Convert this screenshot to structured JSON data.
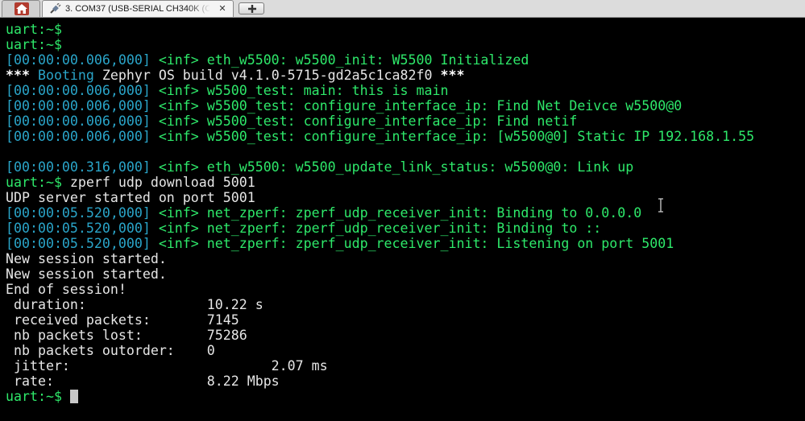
{
  "tabs": {
    "home": {
      "icon": "home-icon"
    },
    "session": {
      "icon": "plug-icon",
      "label": "3. COM37  (USB-SERIAL CH340K (C",
      "close_glyph": "✕"
    },
    "new_tab": {
      "icon": "plus-icon"
    }
  },
  "colors": {
    "background": "#000000",
    "prompt": "#2ee86a",
    "timestamp": "#2aa5c9",
    "log": "#2ee86a",
    "plain": "#e6e6e6"
  },
  "terminal": {
    "lines": [
      {
        "segments": [
          {
            "text": "uart:~$",
            "color": "green"
          }
        ]
      },
      {
        "segments": [
          {
            "text": "uart:~$",
            "color": "green"
          }
        ]
      },
      {
        "segments": [
          {
            "text": "[00:00:00.006,000]",
            "color": "cyan"
          },
          {
            "text": " <inf> eth_w5500: w5500_init: W5500 Initialized",
            "color": "green"
          }
        ]
      },
      {
        "segments": [
          {
            "text": "*** ",
            "color": "bold"
          },
          {
            "text": "Booting",
            "color": "cyan"
          },
          {
            "text": " Zephyr OS build v4.1.0-5715-gd2a5c1ca82f0 ",
            "color": "white"
          },
          {
            "text": "***",
            "color": "bold"
          }
        ]
      },
      {
        "segments": [
          {
            "text": "[00:00:00.006,000]",
            "color": "cyan"
          },
          {
            "text": " <inf> w5500_test: main: this is main",
            "color": "green"
          }
        ]
      },
      {
        "segments": [
          {
            "text": "[00:00:00.006,000]",
            "color": "cyan"
          },
          {
            "text": " <inf> w5500_test: configure_interface_ip: Find Net Deivce w5500@0",
            "color": "green"
          }
        ]
      },
      {
        "segments": [
          {
            "text": "[00:00:00.006,000]",
            "color": "cyan"
          },
          {
            "text": " <inf> w5500_test: configure_interface_ip: Find netif",
            "color": "green"
          }
        ]
      },
      {
        "segments": [
          {
            "text": "[00:00:00.006,000]",
            "color": "cyan"
          },
          {
            "text": " <inf> w5500_test: configure_interface_ip: [w5500@0] Static IP 192.168.1.55",
            "color": "green"
          }
        ]
      },
      {
        "segments": []
      },
      {
        "segments": [
          {
            "text": "[00:00:00.316,000]",
            "color": "cyan"
          },
          {
            "text": " <inf> eth_w5500: w5500_update_link_status: w5500@0: Link up",
            "color": "green"
          }
        ]
      },
      {
        "segments": [
          {
            "text": "uart:~$",
            "color": "green"
          },
          {
            "text": " zperf udp download 5001",
            "color": "white"
          }
        ]
      },
      {
        "segments": [
          {
            "text": "UDP server started on port 5001",
            "color": "white"
          }
        ]
      },
      {
        "segments": [
          {
            "text": "[00:00:05.520,000]",
            "color": "cyan"
          },
          {
            "text": " <inf> net_zperf: zperf_udp_receiver_init: Binding to 0.0.0.0",
            "color": "green"
          }
        ]
      },
      {
        "segments": [
          {
            "text": "[00:00:05.520,000]",
            "color": "cyan"
          },
          {
            "text": " <inf> net_zperf: zperf_udp_receiver_init: Binding to ::",
            "color": "green"
          }
        ]
      },
      {
        "segments": [
          {
            "text": "[00:00:05.520,000]",
            "color": "cyan"
          },
          {
            "text": " <inf> net_zperf: zperf_udp_receiver_init: Listening on port 5001",
            "color": "green"
          }
        ]
      },
      {
        "segments": [
          {
            "text": "New session started.",
            "color": "white"
          }
        ]
      },
      {
        "segments": [
          {
            "text": "New session started.",
            "color": "white"
          }
        ]
      },
      {
        "segments": [
          {
            "text": "End of session!",
            "color": "white"
          }
        ]
      },
      {
        "segments": [
          {
            "text": " duration:               10.22 s",
            "color": "white"
          }
        ]
      },
      {
        "segments": [
          {
            "text": " received packets:       7145",
            "color": "white"
          }
        ]
      },
      {
        "segments": [
          {
            "text": " nb packets lost:        75286",
            "color": "white"
          }
        ]
      },
      {
        "segments": [
          {
            "text": " nb packets outorder:    0",
            "color": "white"
          }
        ]
      },
      {
        "segments": [
          {
            "text": " jitter:                         2.07 ms",
            "color": "white"
          }
        ]
      },
      {
        "segments": [
          {
            "text": " rate:                   8.22 Mbps",
            "color": "white"
          }
        ]
      },
      {
        "segments": [
          {
            "text": "uart:~$",
            "color": "green"
          },
          {
            "text": " ",
            "color": "white"
          }
        ],
        "cursor": true
      }
    ]
  }
}
